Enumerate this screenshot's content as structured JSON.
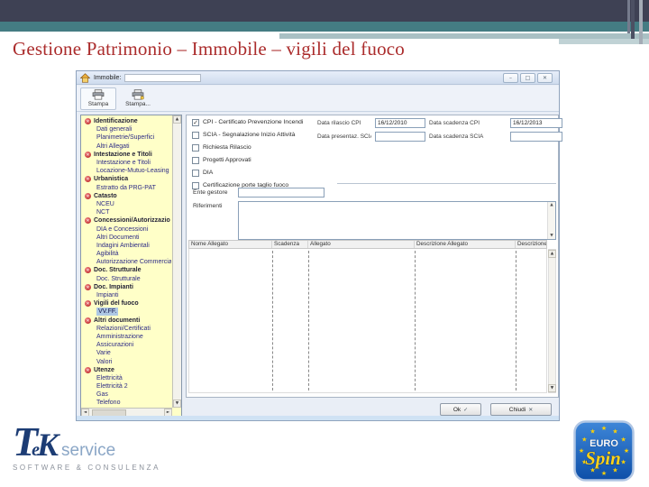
{
  "slide": {
    "title": "Gestione Patrimonio – Immobile – vigili del fuoco"
  },
  "window": {
    "title_label": "Immobile:",
    "controls": {
      "minimize": "–",
      "maximize": "□",
      "close": "✕"
    },
    "toolbar": [
      {
        "label": "Stampa"
      },
      {
        "label": "Stampa..."
      }
    ]
  },
  "icons": {
    "category_glyph": "✕",
    "arrow_up": "▲",
    "arrow_down": "▼",
    "arrow_left": "◄",
    "arrow_right": "►"
  },
  "tree": {
    "items": [
      {
        "label": "Identificazione",
        "type": "cat"
      },
      {
        "label": "Dati generali",
        "type": "child"
      },
      {
        "label": "Planimetrie/Superfici",
        "type": "child"
      },
      {
        "label": "Altri Allegati",
        "type": "child"
      },
      {
        "label": "Intestazione e Titoli",
        "type": "cat"
      },
      {
        "label": "Intestazione e Titoli",
        "type": "child"
      },
      {
        "label": "Locazione-Mutuo-Leasing",
        "type": "child"
      },
      {
        "label": "Urbanistica",
        "type": "cat"
      },
      {
        "label": "Estratto da PRG-PAT",
        "type": "child"
      },
      {
        "label": "Catasto",
        "type": "cat"
      },
      {
        "label": "NCEU",
        "type": "child"
      },
      {
        "label": "NCT",
        "type": "child"
      },
      {
        "label": "Concessioni/Autorizzazio",
        "type": "cat"
      },
      {
        "label": "DIA e Concessioni",
        "type": "child"
      },
      {
        "label": "Altri Documenti",
        "type": "child"
      },
      {
        "label": "Indagini Ambientali",
        "type": "child"
      },
      {
        "label": "Agibilità",
        "type": "child"
      },
      {
        "label": "Autorizzazione Commercial",
        "type": "child"
      },
      {
        "label": "Doc. Strutturale",
        "type": "cat"
      },
      {
        "label": "Doc. Strutturale",
        "type": "child"
      },
      {
        "label": "Doc. Impianti",
        "type": "cat"
      },
      {
        "label": "Impianti",
        "type": "child"
      },
      {
        "label": "Vigili del fuoco",
        "type": "cat"
      },
      {
        "label": "VV.FF.",
        "type": "child sel"
      },
      {
        "label": "Altri documenti",
        "type": "cat"
      },
      {
        "label": "Relazioni/Certificati",
        "type": "child"
      },
      {
        "label": "Amministrazione",
        "type": "child"
      },
      {
        "label": "Assicurazioni",
        "type": "child"
      },
      {
        "label": "Varie",
        "type": "child"
      },
      {
        "label": "Valori",
        "type": "child"
      },
      {
        "label": "Utenze",
        "type": "cat"
      },
      {
        "label": "Elettricità",
        "type": "child"
      },
      {
        "label": "Elettricità 2",
        "type": "child"
      },
      {
        "label": "Gas",
        "type": "child"
      },
      {
        "label": "Telefono",
        "type": "child"
      }
    ]
  },
  "form": {
    "checkboxes": [
      {
        "label": "CPI - Certificato Prevenzione Incendi",
        "mark": "✓"
      },
      {
        "label": "SCIA - Segnalazione Inizio Attività",
        "mark": ""
      },
      {
        "label": "Richiesta Rilascio",
        "mark": ""
      },
      {
        "label": "Progetti Approvati",
        "mark": ""
      },
      {
        "label": "DIA",
        "mark": ""
      },
      {
        "label": "Certificazione porte taglio fuoco",
        "mark": ""
      }
    ],
    "date_fields": [
      {
        "label": "Data rilascio CPI",
        "value": "16/12/2010"
      },
      {
        "label": "Data scadenza CPI",
        "value": "16/12/2013"
      },
      {
        "label": "Data presentaz. SCIA",
        "value": ""
      },
      {
        "label": "Data scadenza SCIA",
        "value": ""
      }
    ],
    "ente_gestore_label": "Ente gestore",
    "riferimenti_label": "Riferimenti",
    "table_headers": [
      "Nome Allegato",
      "Scadenza",
      "Allegato",
      "Descrizione Allegato",
      "Descrizione Tip"
    ],
    "buttons": [
      {
        "label": "Ok",
        "icon": "✓"
      },
      {
        "label": "Chiudi",
        "icon": "✕"
      }
    ]
  },
  "logos": {
    "tek": {
      "t": "T",
      "e": "e",
      "k": "K",
      "service": "service",
      "tagline": "SOFTWARE & CONSULENZA"
    },
    "eurospin": {
      "euro": "EURO",
      "spin": "Spin",
      "star": "★"
    }
  }
}
